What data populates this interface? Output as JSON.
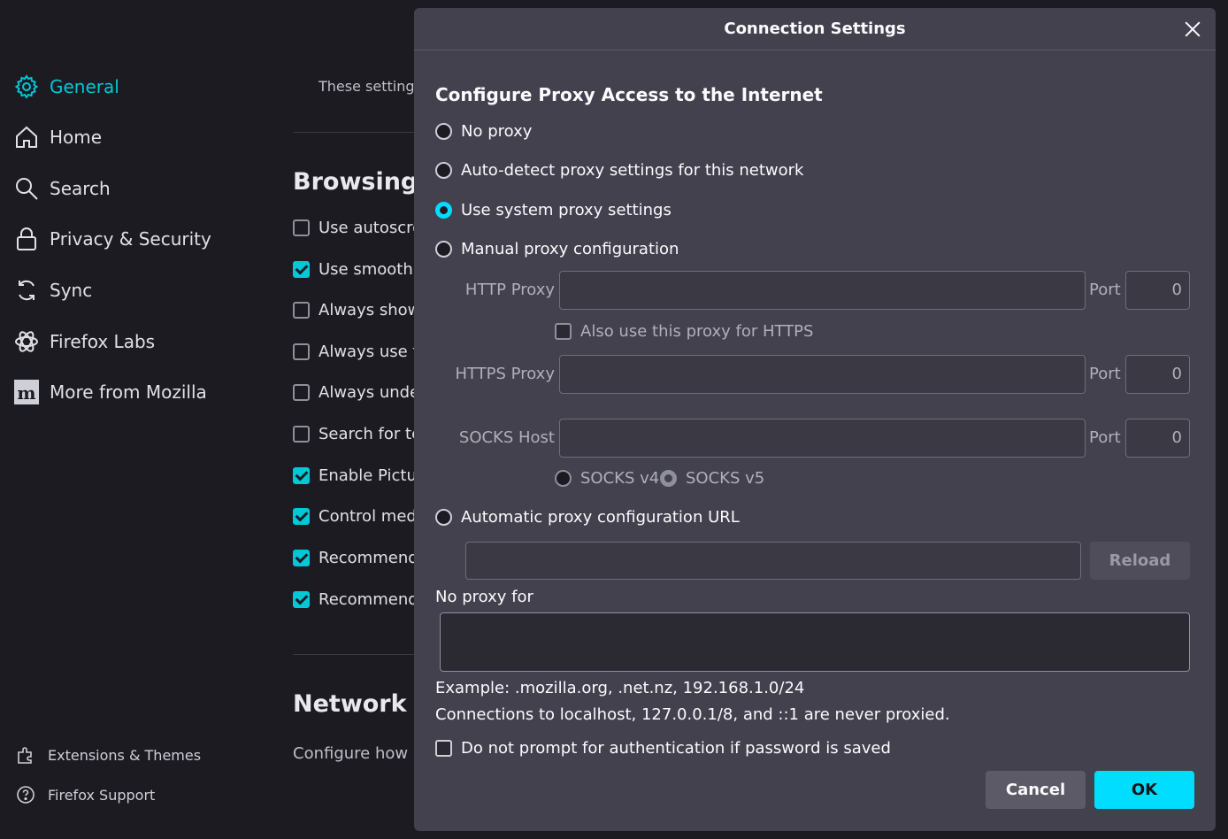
{
  "sidebar": {
    "items": [
      {
        "label": "General",
        "icon": "gear-icon",
        "active": true
      },
      {
        "label": "Home",
        "icon": "home-icon"
      },
      {
        "label": "Search",
        "icon": "search-icon"
      },
      {
        "label": "Privacy & Security",
        "icon": "lock-icon"
      },
      {
        "label": "Sync",
        "icon": "sync-icon"
      },
      {
        "label": "Firefox Labs",
        "icon": "atom-icon"
      },
      {
        "label": "More from Mozilla",
        "icon": "mozilla-m-icon"
      }
    ],
    "footer": [
      {
        "label": "Extensions & Themes",
        "icon": "puzzle-icon"
      },
      {
        "label": "Firefox Support",
        "icon": "help-icon"
      }
    ]
  },
  "background": {
    "settings_note": "These settings",
    "browsing_heading": "Browsing",
    "rows": [
      {
        "label": "Use autoscro",
        "checked": false
      },
      {
        "label": "Use smooth s",
        "checked": true
      },
      {
        "label": "Always show",
        "checked": false
      },
      {
        "label": "Always use th",
        "checked": false
      },
      {
        "label": "Always under",
        "checked": false
      },
      {
        "label": "Search for te",
        "checked": false
      },
      {
        "label": "Enable Pictur",
        "checked": true
      },
      {
        "label": "Control medi",
        "checked": true
      },
      {
        "label": "Recommend",
        "checked": true
      },
      {
        "label": "Recommend",
        "checked": true
      }
    ],
    "network_heading": "Network S",
    "network_desc": "Configure how F"
  },
  "dialog": {
    "title": "Connection Settings",
    "heading": "Configure Proxy Access to the Internet",
    "options": {
      "no_proxy": "No proxy",
      "auto_detect": "Auto-detect proxy settings for this network",
      "system": "Use system proxy settings",
      "manual": "Manual proxy configuration",
      "auto_url": "Automatic proxy configuration URL"
    },
    "selected_option": "system",
    "http_proxy_label": "HTTP Proxy",
    "https_proxy_label": "HTTPS Proxy",
    "socks_host_label": "SOCKS Host",
    "port_label": "Port",
    "http_port": "0",
    "https_port": "0",
    "socks_port": "0",
    "also_https_label": "Also use this proxy for HTTPS",
    "socks_v4": "SOCKS v4",
    "socks_v5": "SOCKS v5",
    "reload_label": "Reload",
    "no_proxy_for_label": "No proxy for",
    "example_text": "Example: .mozilla.org, .net.nz, 192.168.1.0/24",
    "localhost_text": "Connections to localhost, 127.0.0.1/8, and ::1 are never proxied.",
    "auth_prompt_label": "Do not prompt for authentication if password is saved",
    "cancel_label": "Cancel",
    "ok_label": "OK"
  },
  "colors": {
    "accent": "#00ddff",
    "sidebar_active": "#00c8d7",
    "dialog_bg": "#42414d",
    "page_bg": "#1c1b22"
  }
}
